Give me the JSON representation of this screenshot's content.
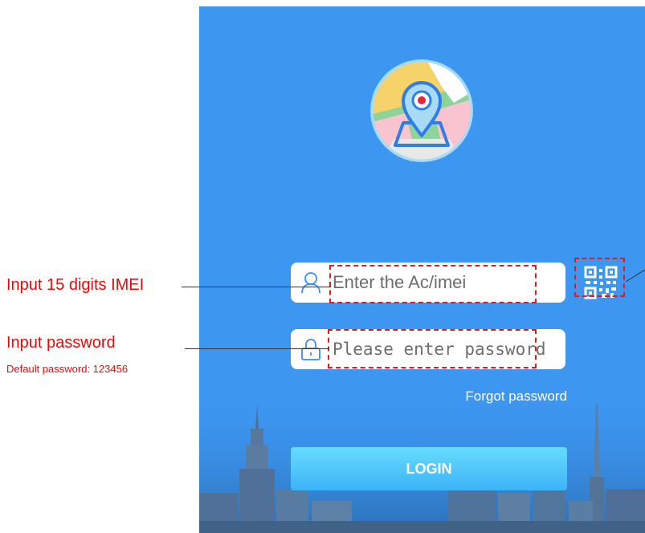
{
  "annotations": {
    "imei_label": "Input 15 digits IMEI",
    "password_label": "Input password",
    "default_password_note": "Default password: 123456"
  },
  "login_form": {
    "account_placeholder": "Enter the Ac/imei",
    "password_placeholder": "Please enter password",
    "forgot_password": "Forgot password",
    "login_button": "LOGIN"
  },
  "icons": {
    "logo": "map-location-pin-icon",
    "account": "user-icon",
    "password": "lock-icon",
    "scan": "qr-code-scan-icon"
  },
  "colors": {
    "screen_background": "#3d96f0",
    "login_button": "#4fc6fb",
    "annotation": "#e60b0b",
    "input_icon": "#3d8cf0"
  }
}
